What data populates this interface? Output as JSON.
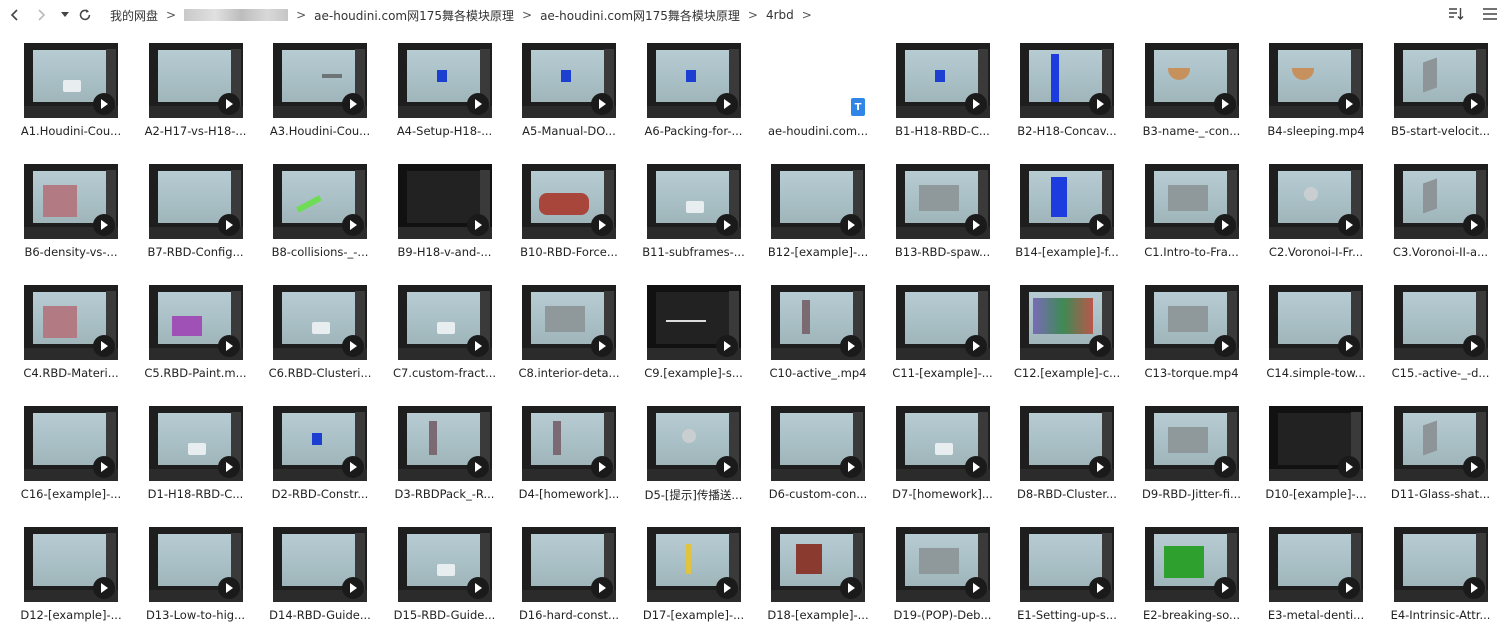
{
  "toolbar": {
    "breadcrumbs": [
      "我的网盘",
      "ae-houdini.com网175舞各模块原理",
      "ae-houdini.com网175舞各模块原理",
      "4rbd"
    ],
    "sep": ">"
  },
  "colors": {
    "play_bg": "#1a1a1a",
    "doc_icon": "#2f86e6"
  },
  "files": [
    {
      "name": "A1.Houdini-Cou...",
      "kind": "video",
      "obj": "white"
    },
    {
      "name": "A2-H17-vs-H18-...",
      "kind": "video",
      "obj": "none"
    },
    {
      "name": "A3.Houdini-Cou...",
      "kind": "video",
      "obj": "ui"
    },
    {
      "name": "A4-Setup-H18-...",
      "kind": "video",
      "obj": "blue"
    },
    {
      "name": "A5-Manual-DO...",
      "kind": "video",
      "obj": "blue"
    },
    {
      "name": "A6-Packing-for-...",
      "kind": "video",
      "obj": "blue"
    },
    {
      "name": "ae-houdini.com...",
      "kind": "doc",
      "obj": "none"
    },
    {
      "name": "B1-H18-RBD-C...",
      "kind": "video",
      "obj": "blue"
    },
    {
      "name": "B2-H18-Concav...",
      "kind": "video",
      "obj": "bluebar"
    },
    {
      "name": "B3-name-_-con...",
      "kind": "video",
      "obj": "bowl"
    },
    {
      "name": "B4-sleeping.mp4",
      "kind": "video",
      "obj": "bowl"
    },
    {
      "name": "B5-start-velocit...",
      "kind": "video",
      "obj": "slab"
    },
    {
      "name": "B6-density-vs-...",
      "kind": "video",
      "obj": "pink"
    },
    {
      "name": "B7-RBD-Config...",
      "kind": "video",
      "obj": "none"
    },
    {
      "name": "B8-collisions-_-...",
      "kind": "video",
      "obj": "green"
    },
    {
      "name": "B9-H18-v-and-...",
      "kind": "dark",
      "obj": "none"
    },
    {
      "name": "B10-RBD-Force...",
      "kind": "video",
      "obj": "red"
    },
    {
      "name": "B11-subframes-...",
      "kind": "video",
      "obj": "white"
    },
    {
      "name": "B12-[example]-...",
      "kind": "video",
      "obj": "none"
    },
    {
      "name": "B13-RBD-spaw...",
      "kind": "video",
      "obj": "grey"
    },
    {
      "name": "B14-[example]-f...",
      "kind": "video",
      "obj": "bluecup"
    },
    {
      "name": "C1.Intro-to-Fra...",
      "kind": "video",
      "obj": "grey"
    },
    {
      "name": "C2.Voronoi-I-Fr...",
      "kind": "video",
      "obj": "sphere"
    },
    {
      "name": "C3.Voronoi-II-a...",
      "kind": "video",
      "obj": "slab"
    },
    {
      "name": "C4.RBD-Materi...",
      "kind": "video",
      "obj": "pink"
    },
    {
      "name": "C5.RBD-Paint.m...",
      "kind": "video",
      "obj": "purple"
    },
    {
      "name": "C6.RBD-Clusteri...",
      "kind": "video",
      "obj": "white"
    },
    {
      "name": "C7.custom-fract...",
      "kind": "video",
      "obj": "white"
    },
    {
      "name": "C8.interior-deta...",
      "kind": "video",
      "obj": "grey"
    },
    {
      "name": "C9.[example]-s...",
      "kind": "dark",
      "obj": "lines"
    },
    {
      "name": "C10-active_.mp4",
      "kind": "video",
      "obj": "statue"
    },
    {
      "name": "C11-[example]-...",
      "kind": "video",
      "obj": "none"
    },
    {
      "name": "C12.[example]-c...",
      "kind": "video",
      "obj": "colorful"
    },
    {
      "name": "C13-torque.mp4",
      "kind": "video",
      "obj": "grey"
    },
    {
      "name": "C14.simple-tow...",
      "kind": "video",
      "obj": "none"
    },
    {
      "name": "C15.-active-_-d...",
      "kind": "video",
      "obj": "none"
    },
    {
      "name": "C16-[example]-...",
      "kind": "video",
      "obj": "none"
    },
    {
      "name": "D1-H18-RBD-C...",
      "kind": "video",
      "obj": "white"
    },
    {
      "name": "D2-RBD-Constr...",
      "kind": "video",
      "obj": "blue"
    },
    {
      "name": "D3-RBDPack_-R...",
      "kind": "video",
      "obj": "statue"
    },
    {
      "name": "D4-[homework]...",
      "kind": "video",
      "obj": "statue"
    },
    {
      "name": "D5-[提示]传播送...",
      "kind": "video",
      "obj": "sphere"
    },
    {
      "name": "D6-custom-con...",
      "kind": "video",
      "obj": "none"
    },
    {
      "name": "D7-[homework]...",
      "kind": "video",
      "obj": "white"
    },
    {
      "name": "D8-RBD-Cluster...",
      "kind": "video",
      "obj": "none"
    },
    {
      "name": "D9-RBD-Jitter-fi...",
      "kind": "video",
      "obj": "grey"
    },
    {
      "name": "D10-[example]-...",
      "kind": "dark",
      "obj": "none"
    },
    {
      "name": "D11-Glass-shat...",
      "kind": "video",
      "obj": "slab"
    },
    {
      "name": "D12-[example]-...",
      "kind": "video",
      "obj": "none"
    },
    {
      "name": "D13-Low-to-hig...",
      "kind": "video",
      "obj": "none"
    },
    {
      "name": "D14-RBD-Guide...",
      "kind": "video",
      "obj": "none"
    },
    {
      "name": "D15-RBD-Guide...",
      "kind": "video",
      "obj": "white"
    },
    {
      "name": "D16-hard-const...",
      "kind": "video",
      "obj": "none"
    },
    {
      "name": "D17-[example]-...",
      "kind": "video",
      "obj": "yellow"
    },
    {
      "name": "D18-[example]-...",
      "kind": "video",
      "obj": "frame"
    },
    {
      "name": "D19-(POP)-Deb...",
      "kind": "video",
      "obj": "grey"
    },
    {
      "name": "E1-Setting-up-s...",
      "kind": "video",
      "obj": "none"
    },
    {
      "name": "E2-breaking-so...",
      "kind": "video",
      "obj": "greencube"
    },
    {
      "name": "E3-metal-denti...",
      "kind": "video",
      "obj": "none"
    },
    {
      "name": "E4-Intrinsic-Attr...",
      "kind": "video",
      "obj": "none"
    }
  ]
}
